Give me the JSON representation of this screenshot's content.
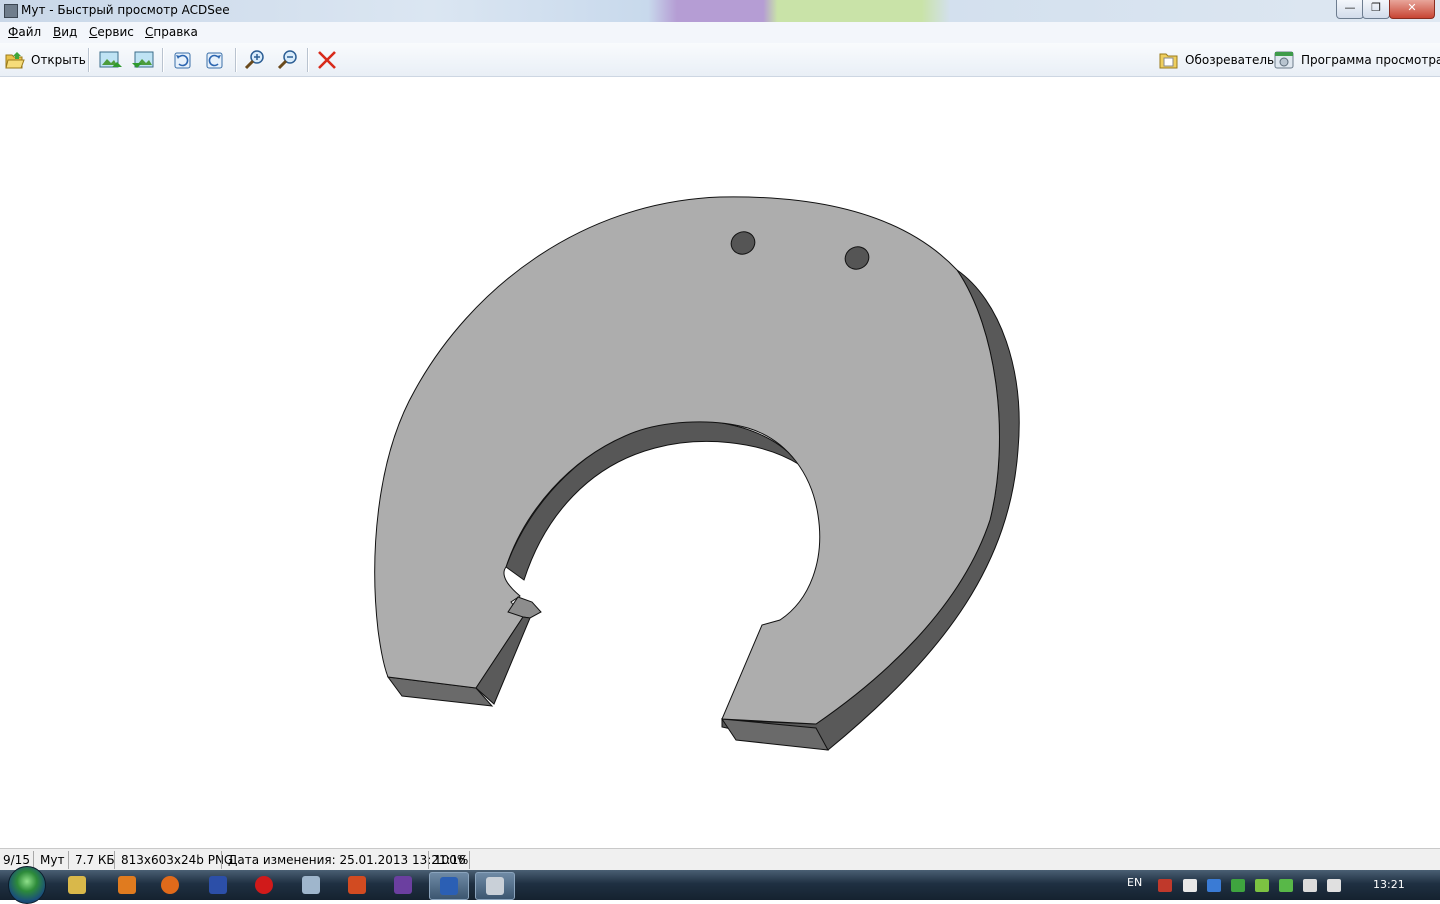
{
  "window": {
    "title": "Мут - Быстрый просмотр ACDSee",
    "buttons": {
      "minimize": "—",
      "maximize": "❐",
      "close": "✕"
    }
  },
  "menu": [
    {
      "label": "Файл",
      "accel": "Ф",
      "rest": "айл"
    },
    {
      "label": "Вид",
      "accel": "В",
      "rest": "ид"
    },
    {
      "label": "Сервис",
      "accel": "С",
      "rest": "ервис"
    },
    {
      "label": "Справка",
      "accel": "С",
      "rest": "правка"
    }
  ],
  "toolbar": {
    "open_label": "Открыть",
    "browser_label": "Обозреватель",
    "viewer_label": "Программа просмотра",
    "icons": [
      "open-icon",
      "prev-image-icon",
      "next-image-icon",
      "rotate-left-icon",
      "rotate-right-icon",
      "zoom-in-icon",
      "zoom-out-icon",
      "delete-icon",
      "browser-icon",
      "viewer-icon"
    ]
  },
  "status": {
    "index": "9/15",
    "name": "Мут",
    "size": "7.7 КБ",
    "info": "813x603x24b PNG",
    "modified": "Дата изменения: 25.01.2013 13:21:16",
    "zoom": "100%"
  },
  "taskbar": {
    "apps": [
      "explorer",
      "media-player",
      "firefox",
      "save-app",
      "opera",
      "calculator",
      "powerpoint",
      "visual-studio",
      "word",
      "acdsee"
    ],
    "active_app": "acdsee",
    "language": "EN",
    "time": "13:21"
  }
}
